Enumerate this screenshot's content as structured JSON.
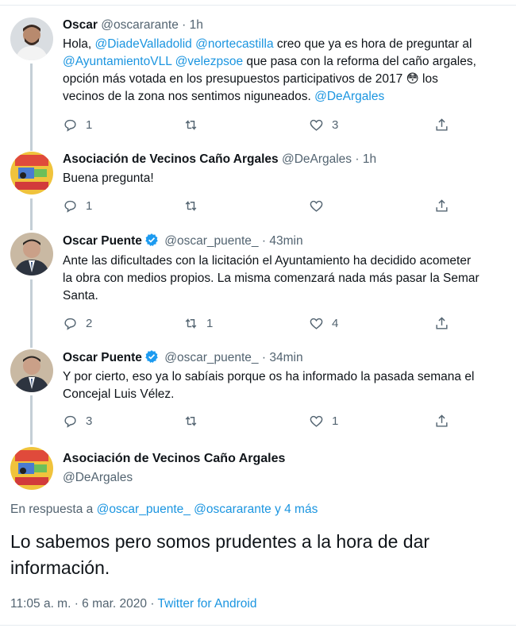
{
  "tweets": [
    {
      "name": "Oscar",
      "handle": "@oscararante",
      "dot": "·",
      "time": "1h",
      "text_parts": [
        "Hola, ",
        "@DiadeValladolid",
        " ",
        "@nortecastilla",
        " creo que ya es hora de preguntar al",
        "@AyuntamientoVLL",
        " ",
        "@velezpsoe",
        " que pasa con la reforma del caño argales,",
        "opción más votada en los presupuestos participativos de 2017 ",
        "😳",
        " los",
        "vecinos de la zona nos sentimos niguneados. ",
        "@DeArgales"
      ],
      "replies": "1",
      "retweets": "",
      "likes": "3"
    },
    {
      "name": "Asociación de Vecinos Caño Argales",
      "handle": "@DeArgales",
      "dot": "·",
      "time": "1h",
      "text_lines": [
        "Buena pregunta!"
      ],
      "replies": "1",
      "retweets": "",
      "likes": ""
    },
    {
      "name": "Oscar Puente",
      "handle": "@oscar_puente_",
      "dot": "·",
      "time": "43min",
      "text_lines": [
        "Ante las dificultades con la licitación el Ayuntamiento ha decidido acometer",
        "la obra con medios propios. La misma comenzará nada más pasar la Semar",
        "Santa."
      ],
      "replies": "2",
      "retweets": "1",
      "likes": "4"
    },
    {
      "name": "Oscar Puente",
      "handle": "@oscar_puente_",
      "dot": "·",
      "time": "34min",
      "text_lines": [
        "Y por cierto, eso ya lo sabíais porque os ha informado la pasada semana el",
        "Concejal Luis Vélez."
      ],
      "replies": "3",
      "retweets": "",
      "likes": "1"
    }
  ],
  "main_tweet": {
    "name": "Asociación de Vecinos Caño Argales",
    "handle": "@DeArgales",
    "reply_prefix": "En respuesta a ",
    "reply_handles": "@oscar_puente_ @oscararante y 4 más",
    "text_line1": "Lo sabemos pero somos prudentes a la hora de dar",
    "text_line2": "información.",
    "timestamp": "11:05 a. m. · 6 mar. 2020 · ",
    "source": "Twitter for Android"
  },
  "colors": {
    "link": "#1b95e0",
    "muted": "#536471",
    "verified": "#1d9bf0"
  },
  "icons": [
    "reply-icon",
    "retweet-icon",
    "like-icon",
    "share-icon",
    "verified-icon"
  ]
}
